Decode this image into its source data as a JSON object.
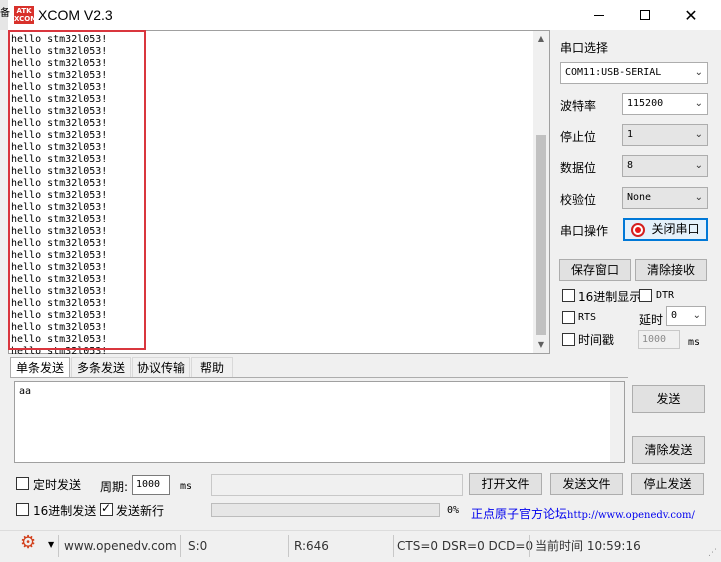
{
  "window": {
    "title": "XCOM V2.3",
    "logo_text": "ATK XCOM",
    "left_strip_char": "备"
  },
  "receive": {
    "lines": [
      "hello stm32l053!",
      "hello stm32l053!",
      "hello stm32l053!",
      "hello stm32l053!",
      "hello stm32l053!",
      "hello stm32l053!",
      "hello stm32l053!",
      "hello stm32l053!",
      "hello stm32l053!",
      "hello stm32l053!",
      "hello stm32l053!",
      "hello stm32l053!",
      "hello stm32l053!",
      "hello stm32l053!",
      "hello stm32l053!",
      "hello stm32l053!",
      "hello stm32l053!",
      "hello stm32l053!",
      "hello stm32l053!",
      "hello stm32l053!",
      "hello stm32l053!",
      "hello stm32l053!",
      "hello stm32l053!",
      "hello stm32l053!",
      "hello stm32l053!",
      "hello stm32l053!",
      "hello stm32l053!"
    ]
  },
  "settings": {
    "port_label": "串口选择",
    "port_value": "COM11:USB-SERIAL",
    "baud_label": "波特率",
    "baud_value": "115200",
    "stop_label": "停止位",
    "stop_value": "1",
    "data_label": "数据位",
    "data_value": "8",
    "parity_label": "校验位",
    "parity_value": "None",
    "op_label": "串口操作",
    "close_port": "关闭串口",
    "save_window": "保存窗口",
    "clear_recv": "清除接收",
    "hex_display": "16进制显示",
    "dtr": "DTR",
    "rts": "RTS",
    "delay_label": "延时",
    "delay_value": "0",
    "timestamp": "时间戳",
    "timestamp_value": "1000",
    "ms": "ms"
  },
  "tabs": [
    "单条发送",
    "多条发送",
    "协议传输",
    "帮助"
  ],
  "send": {
    "text": "aa",
    "send_button": "发送",
    "clear_send": "清除发送",
    "timed_send": "定时发送",
    "period_label": "周期:",
    "period_value": "1000",
    "ms": "ms",
    "open_file": "打开文件",
    "send_file": "发送文件",
    "stop_send": "停止发送",
    "hex_send": "16进制发送",
    "send_newline": "发送新行",
    "progress": "0%",
    "link_text": "正点原子官方论坛",
    "link_url": "http://www.openedv.com/"
  },
  "status": {
    "website": "www.openedv.com",
    "s": "S:0",
    "r": "R:646",
    "lines": "CTS=0 DSR=0 DCD=0",
    "time": "当前时间 10:59:16"
  },
  "colors": {
    "highlight": "#d9363e",
    "led": "#e81818",
    "focus": "#0078d7"
  }
}
